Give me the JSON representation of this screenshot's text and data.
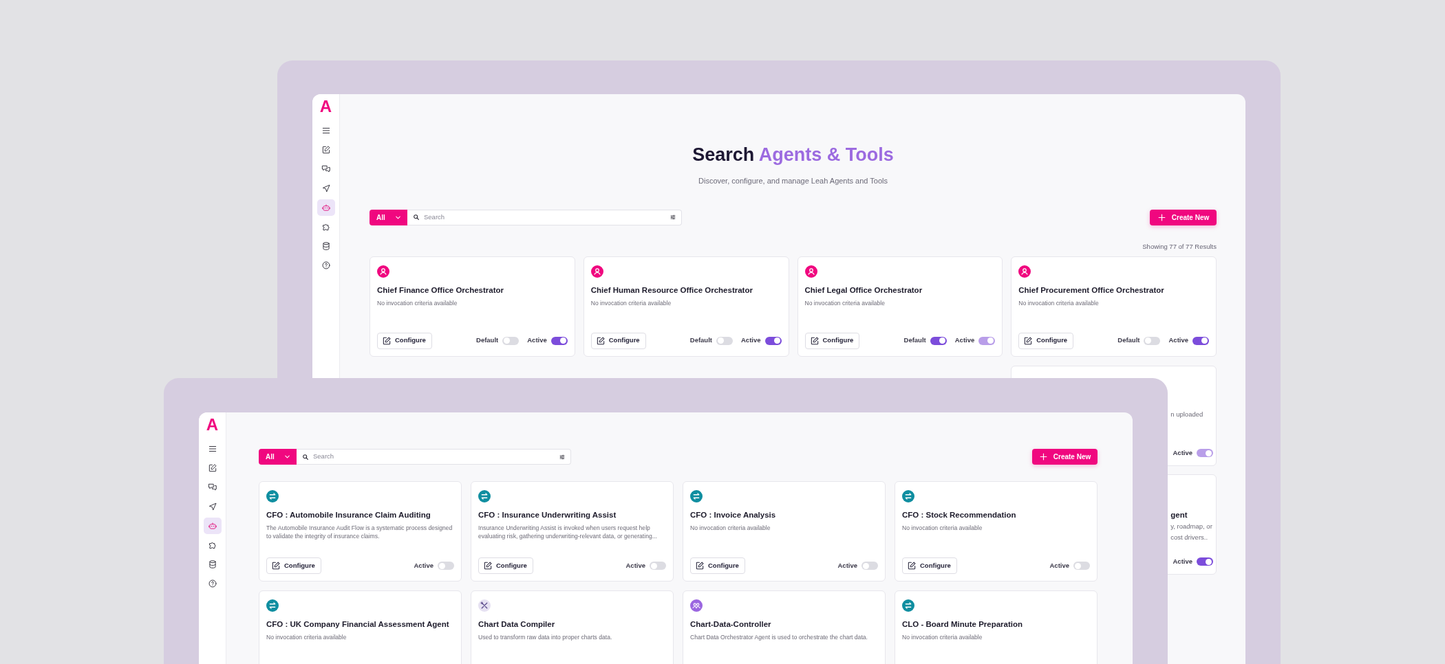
{
  "back_window": {
    "logo": "A",
    "sidebar": {
      "items": [
        {
          "kind": "menu",
          "selected": false
        },
        {
          "kind": "edit",
          "selected": false
        },
        {
          "kind": "chat",
          "selected": false
        },
        {
          "kind": "send",
          "selected": false
        },
        {
          "kind": "bot",
          "selected": true
        },
        {
          "kind": "puzzle",
          "selected": false
        },
        {
          "kind": "database",
          "selected": false
        },
        {
          "kind": "help",
          "selected": false
        }
      ]
    },
    "heading": {
      "text": "Search",
      "accent": "Agents & Tools"
    },
    "subtitle": "Discover, configure, and manage Leah Agents and Tools",
    "filter": {
      "label": "All"
    },
    "search": {
      "placeholder": "Search"
    },
    "create_button": "Create New",
    "results": "Showing 77 of 77 Results",
    "cards": [
      {
        "kind": "person",
        "title": "Chief Finance Office Orchestrator",
        "description": "No invocation criteria available",
        "button": "Configure",
        "toggles": [
          {
            "label": "Default",
            "on": false,
            "disabled": false
          },
          {
            "label": "Active",
            "on": true,
            "disabled": false
          }
        ]
      },
      {
        "kind": "person",
        "title": "Chief Human Resource Office Orchestrator",
        "description": "No invocation criteria available",
        "button": "Configure",
        "toggles": [
          {
            "label": "Default",
            "on": false,
            "disabled": false
          },
          {
            "label": "Active",
            "on": true,
            "disabled": false
          }
        ]
      },
      {
        "kind": "person",
        "title": "Chief Legal Office Orchestrator",
        "description": "No invocation criteria available",
        "button": "Configure",
        "toggles": [
          {
            "label": "Default",
            "on": true,
            "disabled": false
          },
          {
            "label": "Active",
            "on": true,
            "disabled": true
          }
        ]
      },
      {
        "kind": "person",
        "title": "Chief Procurement Office Orchestrator",
        "description": "No invocation criteria available",
        "button": "Configure",
        "toggles": [
          {
            "label": "Default",
            "on": false,
            "disabled": false
          },
          {
            "label": "Active",
            "on": true,
            "disabled": false
          }
        ]
      }
    ],
    "partial_cards": [
      {
        "description_lines": [
          "n uploaded"
        ],
        "toggles": [
          {
            "label": "Active",
            "on": true,
            "disabled": true
          }
        ]
      },
      {
        "title": "gent",
        "description_lines": [
          "y, roadmap, or",
          "cost drivers.."
        ],
        "toggles": [
          {
            "label": "Active",
            "on": true,
            "disabled": false
          }
        ]
      }
    ]
  },
  "front_window": {
    "logo": "A",
    "sidebar": {
      "items": [
        {
          "kind": "menu",
          "selected": false
        },
        {
          "kind": "edit",
          "selected": false
        },
        {
          "kind": "chat",
          "selected": false
        },
        {
          "kind": "send",
          "selected": false
        },
        {
          "kind": "bot",
          "selected": true
        },
        {
          "kind": "puzzle",
          "selected": false
        },
        {
          "kind": "database",
          "selected": false
        },
        {
          "kind": "help",
          "selected": false
        }
      ]
    },
    "filter": {
      "label": "All"
    },
    "search": {
      "placeholder": "Search"
    },
    "create_button": "Create New",
    "cards": [
      {
        "kind": "swap",
        "title": "CFO : Automobile Insurance Claim Auditing",
        "description": "The Automobile Insurance Audit Flow is a systematic process designed to validate the integrity of insurance claims.",
        "button": "Configure",
        "toggles": [
          {
            "label": "Active",
            "on": false,
            "disabled": false
          }
        ]
      },
      {
        "kind": "swap",
        "title": "CFO : Insurance Underwriting Assist",
        "description": "Insurance Underwriting Assist is invoked when users request help evaluating risk, gathering underwriting-relevant data, or generating...",
        "button": "Configure",
        "toggles": [
          {
            "label": "Active",
            "on": false,
            "disabled": false
          }
        ]
      },
      {
        "kind": "swap",
        "title": "CFO : Invoice Analysis",
        "description": "No invocation criteria available",
        "button": "Configure",
        "toggles": [
          {
            "label": "Active",
            "on": false,
            "disabled": false
          }
        ]
      },
      {
        "kind": "swap",
        "title": "CFO : Stock Recommendation",
        "description": "No invocation criteria available",
        "button": "Configure",
        "toggles": [
          {
            "label": "Active",
            "on": false,
            "disabled": false
          }
        ]
      },
      {
        "kind": "swap",
        "title": "CFO : UK Company Financial Assessment Agent",
        "description": "No invocation criteria available"
      },
      {
        "kind": "tools",
        "title": "Chart Data Compiler",
        "description": "Used to transform raw data into proper charts data."
      },
      {
        "kind": "group",
        "title": "Chart-Data-Controller",
        "description": "Chart Data Orchestrator Agent is used to orchestrate the chart data."
      },
      {
        "kind": "swap",
        "title": "CLO - Board Minute Preparation",
        "description": "No invocation criteria available"
      }
    ]
  }
}
